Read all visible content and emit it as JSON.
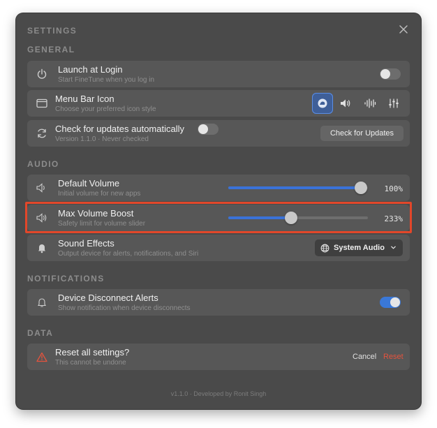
{
  "window": {
    "title": "SETTINGS"
  },
  "sections": {
    "general": "GENERAL",
    "audio": "AUDIO",
    "notifications": "NOTIFICATIONS",
    "data": "DATA"
  },
  "general": {
    "launch_at_login": {
      "title": "Launch at Login",
      "subtitle": "Start FineTune when you log in",
      "enabled": false
    },
    "menu_bar_icon": {
      "title": "Menu Bar Icon",
      "subtitle": "Choose your preferred icon style",
      "options": [
        "app-logo-icon",
        "speaker-icon",
        "waveform-icon",
        "sliders-icon"
      ],
      "selected": "app-logo-icon"
    },
    "updates": {
      "title": "Check for updates automatically",
      "subtitle": "Version 1.1.0 · Never checked",
      "enabled": false,
      "button_label": "Check for Updates"
    }
  },
  "audio": {
    "default_volume": {
      "title": "Default Volume",
      "subtitle": "Initial volume for new apps",
      "value_label": "100%",
      "level": 0.95
    },
    "max_volume_boost": {
      "title": "Max Volume Boost",
      "subtitle": "Safety limit for volume slider",
      "value_label": "233%",
      "level": 0.45
    },
    "sound_effects": {
      "title": "Sound Effects",
      "subtitle": "Output device for alerts, notifications, and Siri",
      "selected_device": "System Audio"
    }
  },
  "notifications": {
    "device_disconnect": {
      "title": "Device Disconnect Alerts",
      "subtitle": "Show notification when device disconnects",
      "enabled": true
    }
  },
  "data": {
    "reset": {
      "title": "Reset all settings?",
      "subtitle": "This cannot be undone",
      "cancel_label": "Cancel",
      "reset_label": "Reset"
    }
  },
  "footer": {
    "text": "v1.1.0 · Developed by Ronit Singh"
  },
  "colors": {
    "accent": "#3a78d8",
    "danger": "#e5533d",
    "window_bg": "#4a4a4a",
    "row_bg": "#575757",
    "highlight": "#e2472a"
  }
}
